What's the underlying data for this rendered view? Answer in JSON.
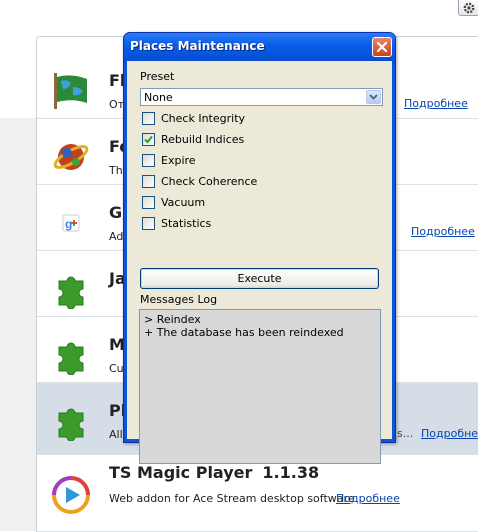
{
  "dialog": {
    "title": "Places Maintenance",
    "preset_label": "Preset",
    "preset_value": "None",
    "options": [
      {
        "label": "Check Integrity",
        "checked": false
      },
      {
        "label": "Rebuild Indices",
        "checked": true
      },
      {
        "label": "Expire",
        "checked": false
      },
      {
        "label": "Check Coherence",
        "checked": false
      },
      {
        "label": "Vacuum",
        "checked": false
      },
      {
        "label": "Statistics",
        "checked": false
      }
    ],
    "execute_label": "Execute",
    "log_label": "Messages Log",
    "log_lines": [
      "> Reindex",
      "+ The database has been reindexed"
    ]
  },
  "addons": [
    {
      "name": "Fl",
      "desc": "От",
      "more": "Подробнее"
    },
    {
      "name": "Fo",
      "desc": "The",
      "more": ""
    },
    {
      "name": "G",
      "desc": "Add",
      "more": "Подробнее"
    },
    {
      "name": "Ja",
      "desc": "",
      "more": ""
    },
    {
      "name": "M",
      "desc": "Cus",
      "more": ""
    },
    {
      "name": "Pl",
      "desc": "Allo",
      "more": "Подробнее"
    },
    {
      "name": "TS Magic Player",
      "version": "1.1.38",
      "desc": "Web addon for Ace Stream desktop software",
      "more": "Подробнее"
    }
  ],
  "colors": {
    "titlebar": "#0a5ee8",
    "link": "#0645ad",
    "selected_row": "#d5dde6",
    "puzzle_green": "#3a9a2a"
  }
}
